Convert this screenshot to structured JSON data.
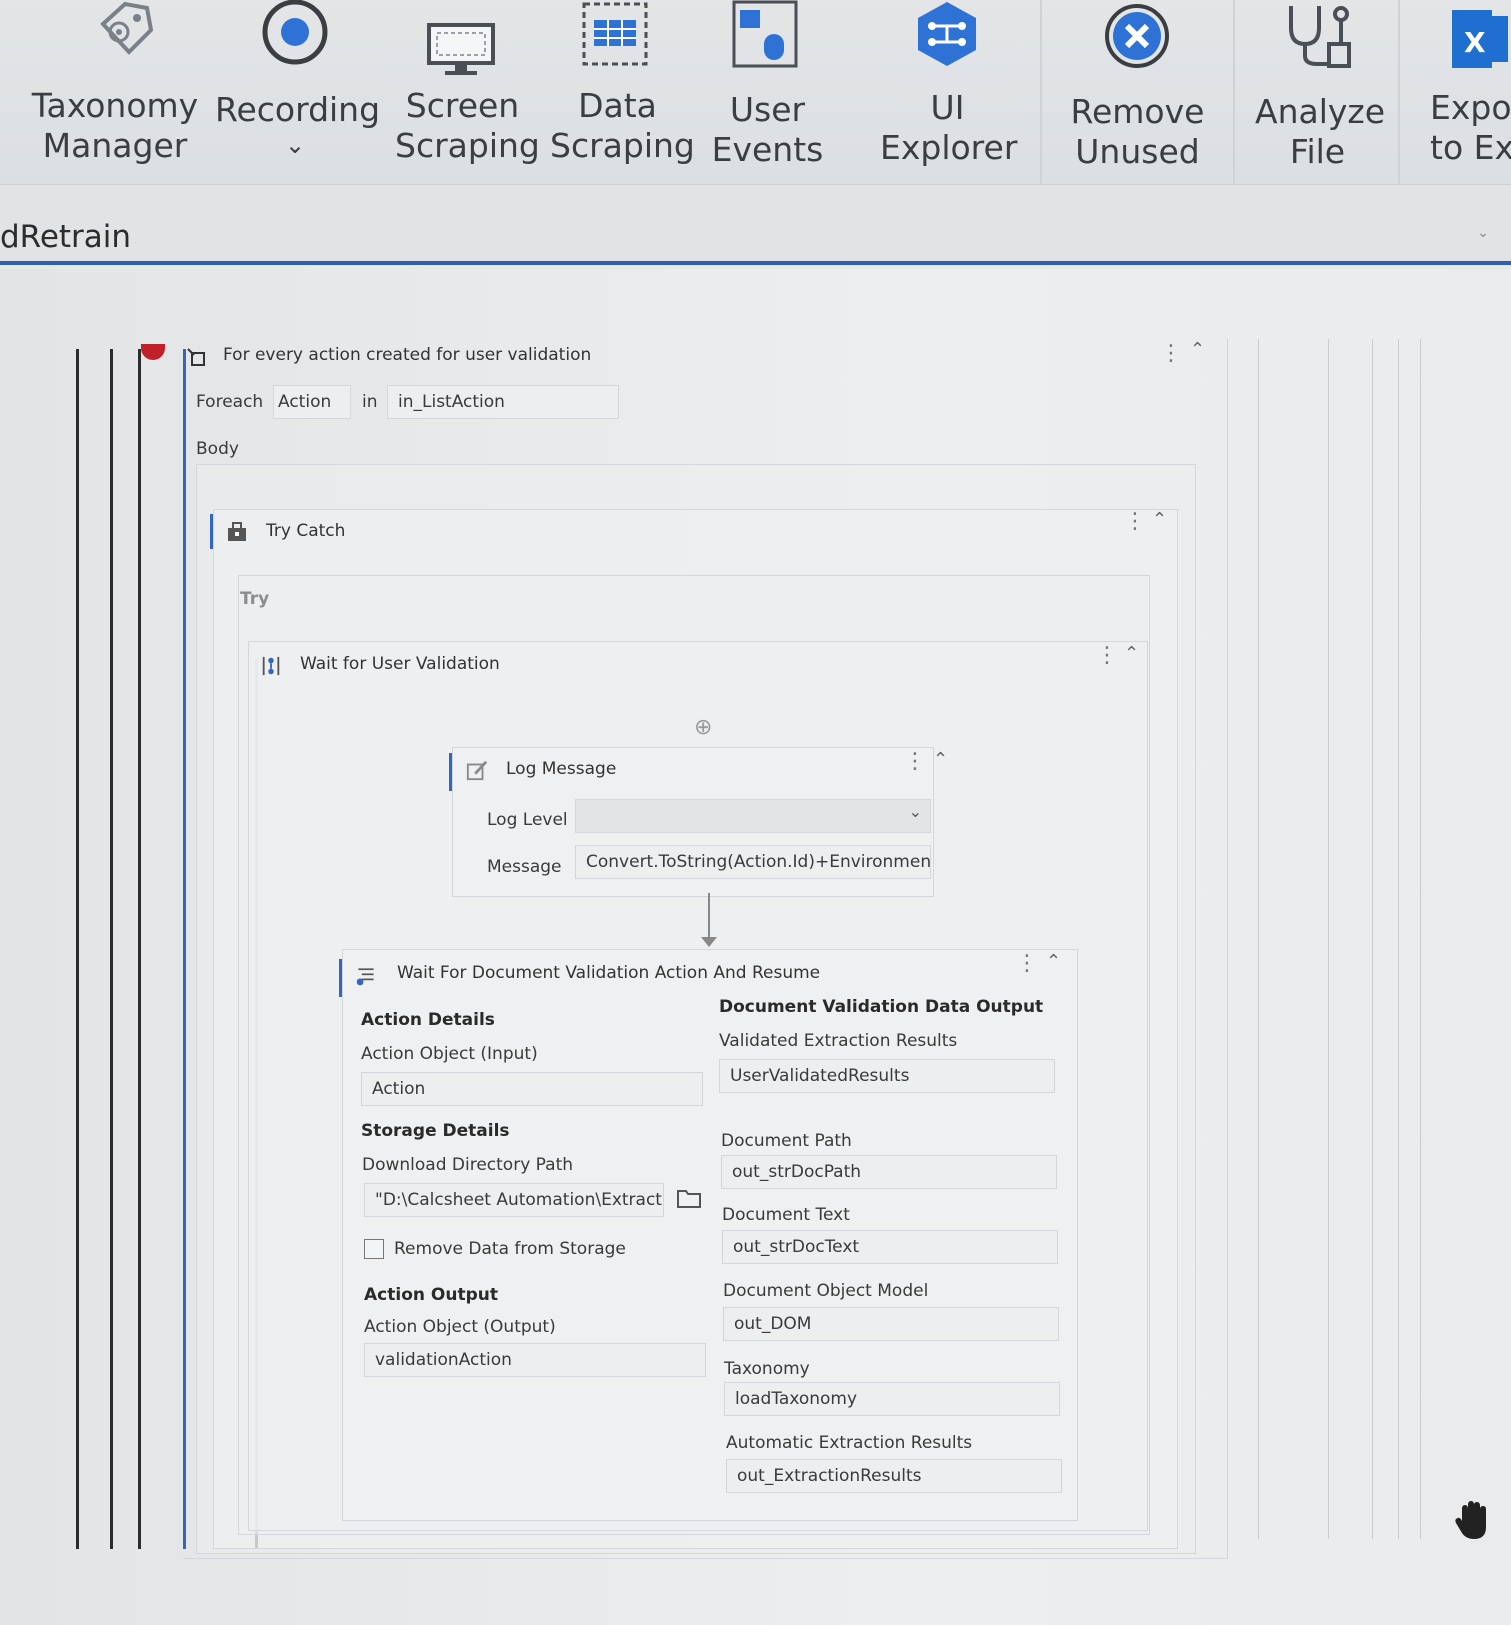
{
  "ribbon": {
    "buttons": [
      {
        "name": "taxonomy-manager",
        "line1": "Taxonomy",
        "line2": "Manager",
        "icon": "tag-gear-icon"
      },
      {
        "name": "recording",
        "line1": "Recording",
        "line2": "",
        "icon": "record-icon",
        "dropdown": true
      },
      {
        "name": "screen-scraping",
        "line1": "Screen",
        "line2": "Scraping",
        "icon": "monitor-icon"
      },
      {
        "name": "data-scraping",
        "line1": "Data",
        "line2": "Scraping",
        "icon": "table-dashed-icon"
      },
      {
        "name": "user-events",
        "line1": "User",
        "line2": "Events",
        "icon": "mouse-click-icon",
        "dropdown": true
      },
      {
        "name": "ui-explorer",
        "line1": "UI",
        "line2": "Explorer",
        "icon": "hexagon-network-icon"
      },
      {
        "name": "remove-unused",
        "line1": "Remove",
        "line2": "Unused",
        "icon": "remove-circle-icon",
        "dropdown": true
      },
      {
        "name": "analyze-file",
        "line1": "Analyze",
        "line2": "File",
        "icon": "stethoscope-icon",
        "dropdown": true
      },
      {
        "name": "export-to-excel",
        "line1": "Expor",
        "line2": "to Exc",
        "icon": "excel-icon"
      }
    ],
    "dropdown_glyph": "⌄",
    "accent_blue": "#2f72d6",
    "excel_blue": "#1f6fd0"
  },
  "tab": {
    "title": "dRetrain"
  },
  "foreach": {
    "title": "For every action created for user validation",
    "foreach_label": "Foreach",
    "item_value": "Action",
    "in_label": "in",
    "collection_value": "in_ListAction",
    "body_label": "Body"
  },
  "trycatch": {
    "title": "Try Catch",
    "try_label": "Try"
  },
  "wait_user": {
    "title": "Wait for User Validation"
  },
  "log_message": {
    "title": "Log Message",
    "level_label": "Log Level",
    "level_value": "",
    "message_label": "Message",
    "message_value": "Convert.ToString(Action.Id)+Environment.N"
  },
  "wait_doc": {
    "title": "Wait For Document Validation Action And Resume",
    "action_details": "Action Details",
    "action_object_input_label": "Action Object (Input)",
    "action_object_input_value": "Action",
    "storage_details": "Storage Details",
    "download_path_label": "Download Directory Path",
    "download_path_value": "\"D:\\Calcsheet Automation\\Extractic",
    "remove_data_label": "Remove Data from Storage",
    "remove_data_checked": false,
    "action_output": "Action Output",
    "action_object_output_label": "Action Object (Output)",
    "action_object_output_value": "validationAction",
    "doc_validation_output": "Document Validation Data Output",
    "validated_label": "Validated Extraction Results",
    "validated_value": "UserValidatedResults",
    "doc_path_label": "Document Path",
    "doc_path_value": "out_strDocPath",
    "doc_text_label": "Document Text",
    "doc_text_value": "out_strDocText",
    "dom_label": "Document Object Model",
    "dom_value": "out_DOM",
    "taxonomy_label": "Taxonomy",
    "taxonomy_value": "loadTaxonomy",
    "auto_label": "Automatic Extraction Results",
    "auto_value": "out_ExtractionResults"
  },
  "glyphs": {
    "menu": "⋮",
    "collapse": "⌃",
    "dropdown": "⌄",
    "add": "⊕"
  }
}
